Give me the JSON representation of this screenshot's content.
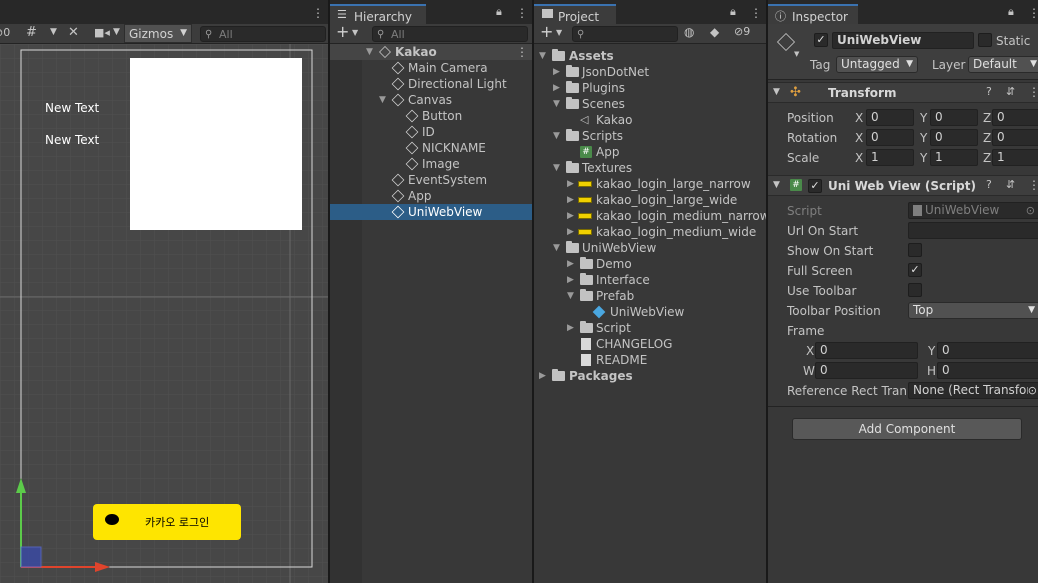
{
  "scene": {
    "toolbar_count": "0",
    "gizmos_label": "Gizmos",
    "search_placeholder": "All",
    "text1": "New Text",
    "text2": "New Text",
    "kakao_button_label": "카카오 로그인",
    "colors": {
      "kakao_yellow": "#fee500",
      "axis_green": "#5ccb4a",
      "axis_red": "#e0442c"
    }
  },
  "hierarchy": {
    "tab_label": "Hierarchy",
    "search_placeholder": "All",
    "add_label": "+",
    "items": [
      {
        "label": "Kakao",
        "icon": "unity-scene-icon"
      },
      {
        "label": "Main Camera",
        "icon": "gameobject-icon"
      },
      {
        "label": "Directional Light",
        "icon": "gameobject-icon"
      },
      {
        "label": "Canvas",
        "icon": "gameobject-icon"
      },
      {
        "label": "Button",
        "icon": "gameobject-icon"
      },
      {
        "label": "ID",
        "icon": "gameobject-icon"
      },
      {
        "label": "NICKNAME",
        "icon": "gameobject-icon"
      },
      {
        "label": "Image",
        "icon": "gameobject-icon"
      },
      {
        "label": "EventSystem",
        "icon": "gameobject-icon"
      },
      {
        "label": "App",
        "icon": "gameobject-icon"
      },
      {
        "label": "UniWebView",
        "icon": "gameobject-icon"
      }
    ]
  },
  "project": {
    "tab_label": "Project",
    "add_label": "+",
    "hidden_count": "9",
    "items": [
      {
        "label": "Assets",
        "icon": "folder-open-icon"
      },
      {
        "label": "JsonDotNet",
        "icon": "folder-icon"
      },
      {
        "label": "Plugins",
        "icon": "folder-icon"
      },
      {
        "label": "Scenes",
        "icon": "folder-open-icon"
      },
      {
        "label": "Kakao",
        "icon": "unity-scene-icon"
      },
      {
        "label": "Scripts",
        "icon": "folder-open-icon"
      },
      {
        "label": "App",
        "icon": "csharp-script-icon"
      },
      {
        "label": "Textures",
        "icon": "folder-open-icon"
      },
      {
        "label": "kakao_login_large_narrow",
        "icon": "texture-icon"
      },
      {
        "label": "kakao_login_large_wide",
        "icon": "texture-icon"
      },
      {
        "label": "kakao_login_medium_narrow",
        "icon": "texture-icon"
      },
      {
        "label": "kakao_login_medium_wide",
        "icon": "texture-icon"
      },
      {
        "label": "UniWebView",
        "icon": "folder-open-icon"
      },
      {
        "label": "Demo",
        "icon": "folder-icon"
      },
      {
        "label": "Interface",
        "icon": "folder-icon"
      },
      {
        "label": "Prefab",
        "icon": "folder-open-icon"
      },
      {
        "label": "UniWebView",
        "icon": "prefab-icon"
      },
      {
        "label": "Script",
        "icon": "folder-icon"
      },
      {
        "label": "CHANGELOG",
        "icon": "text-file-icon"
      },
      {
        "label": "README",
        "icon": "text-file-icon"
      },
      {
        "label": "Packages",
        "icon": "folder-icon"
      }
    ]
  },
  "inspector": {
    "tab_label": "Inspector",
    "object_name": "UniWebView",
    "static_label": "Static",
    "tag_label": "Tag",
    "tag_value": "Untagged",
    "layer_label": "Layer",
    "layer_value": "Default",
    "transform": {
      "title": "Transform",
      "position_label": "Position",
      "rotation_label": "Rotation",
      "scale_label": "Scale",
      "position": {
        "x": "0",
        "y": "0",
        "z": "0"
      },
      "rotation": {
        "x": "0",
        "y": "0",
        "z": "0"
      },
      "scale": {
        "x": "1",
        "y": "1",
        "z": "1"
      }
    },
    "script_component": {
      "title": "Uni Web View (Script)",
      "script_label": "Script",
      "script_value": "UniWebView",
      "url_on_start_label": "Url On Start",
      "url_on_start_value": "",
      "show_on_start_label": "Show On Start",
      "show_on_start": false,
      "full_screen_label": "Full Screen",
      "full_screen": true,
      "use_toolbar_label": "Use Toolbar",
      "use_toolbar": false,
      "toolbar_position_label": "Toolbar Position",
      "toolbar_position_value": "Top",
      "frame_label": "Frame",
      "frame": {
        "x": "0",
        "y": "0",
        "w": "0",
        "h": "0"
      },
      "reference_rect_label": "Reference Rect Trans",
      "reference_rect_value": "None (Rect Transfor"
    },
    "add_component_label": "Add Component"
  },
  "axis_labels": {
    "x": "X",
    "y": "Y",
    "z": "Z",
    "w": "W",
    "h": "H"
  },
  "checkmark": "✓"
}
